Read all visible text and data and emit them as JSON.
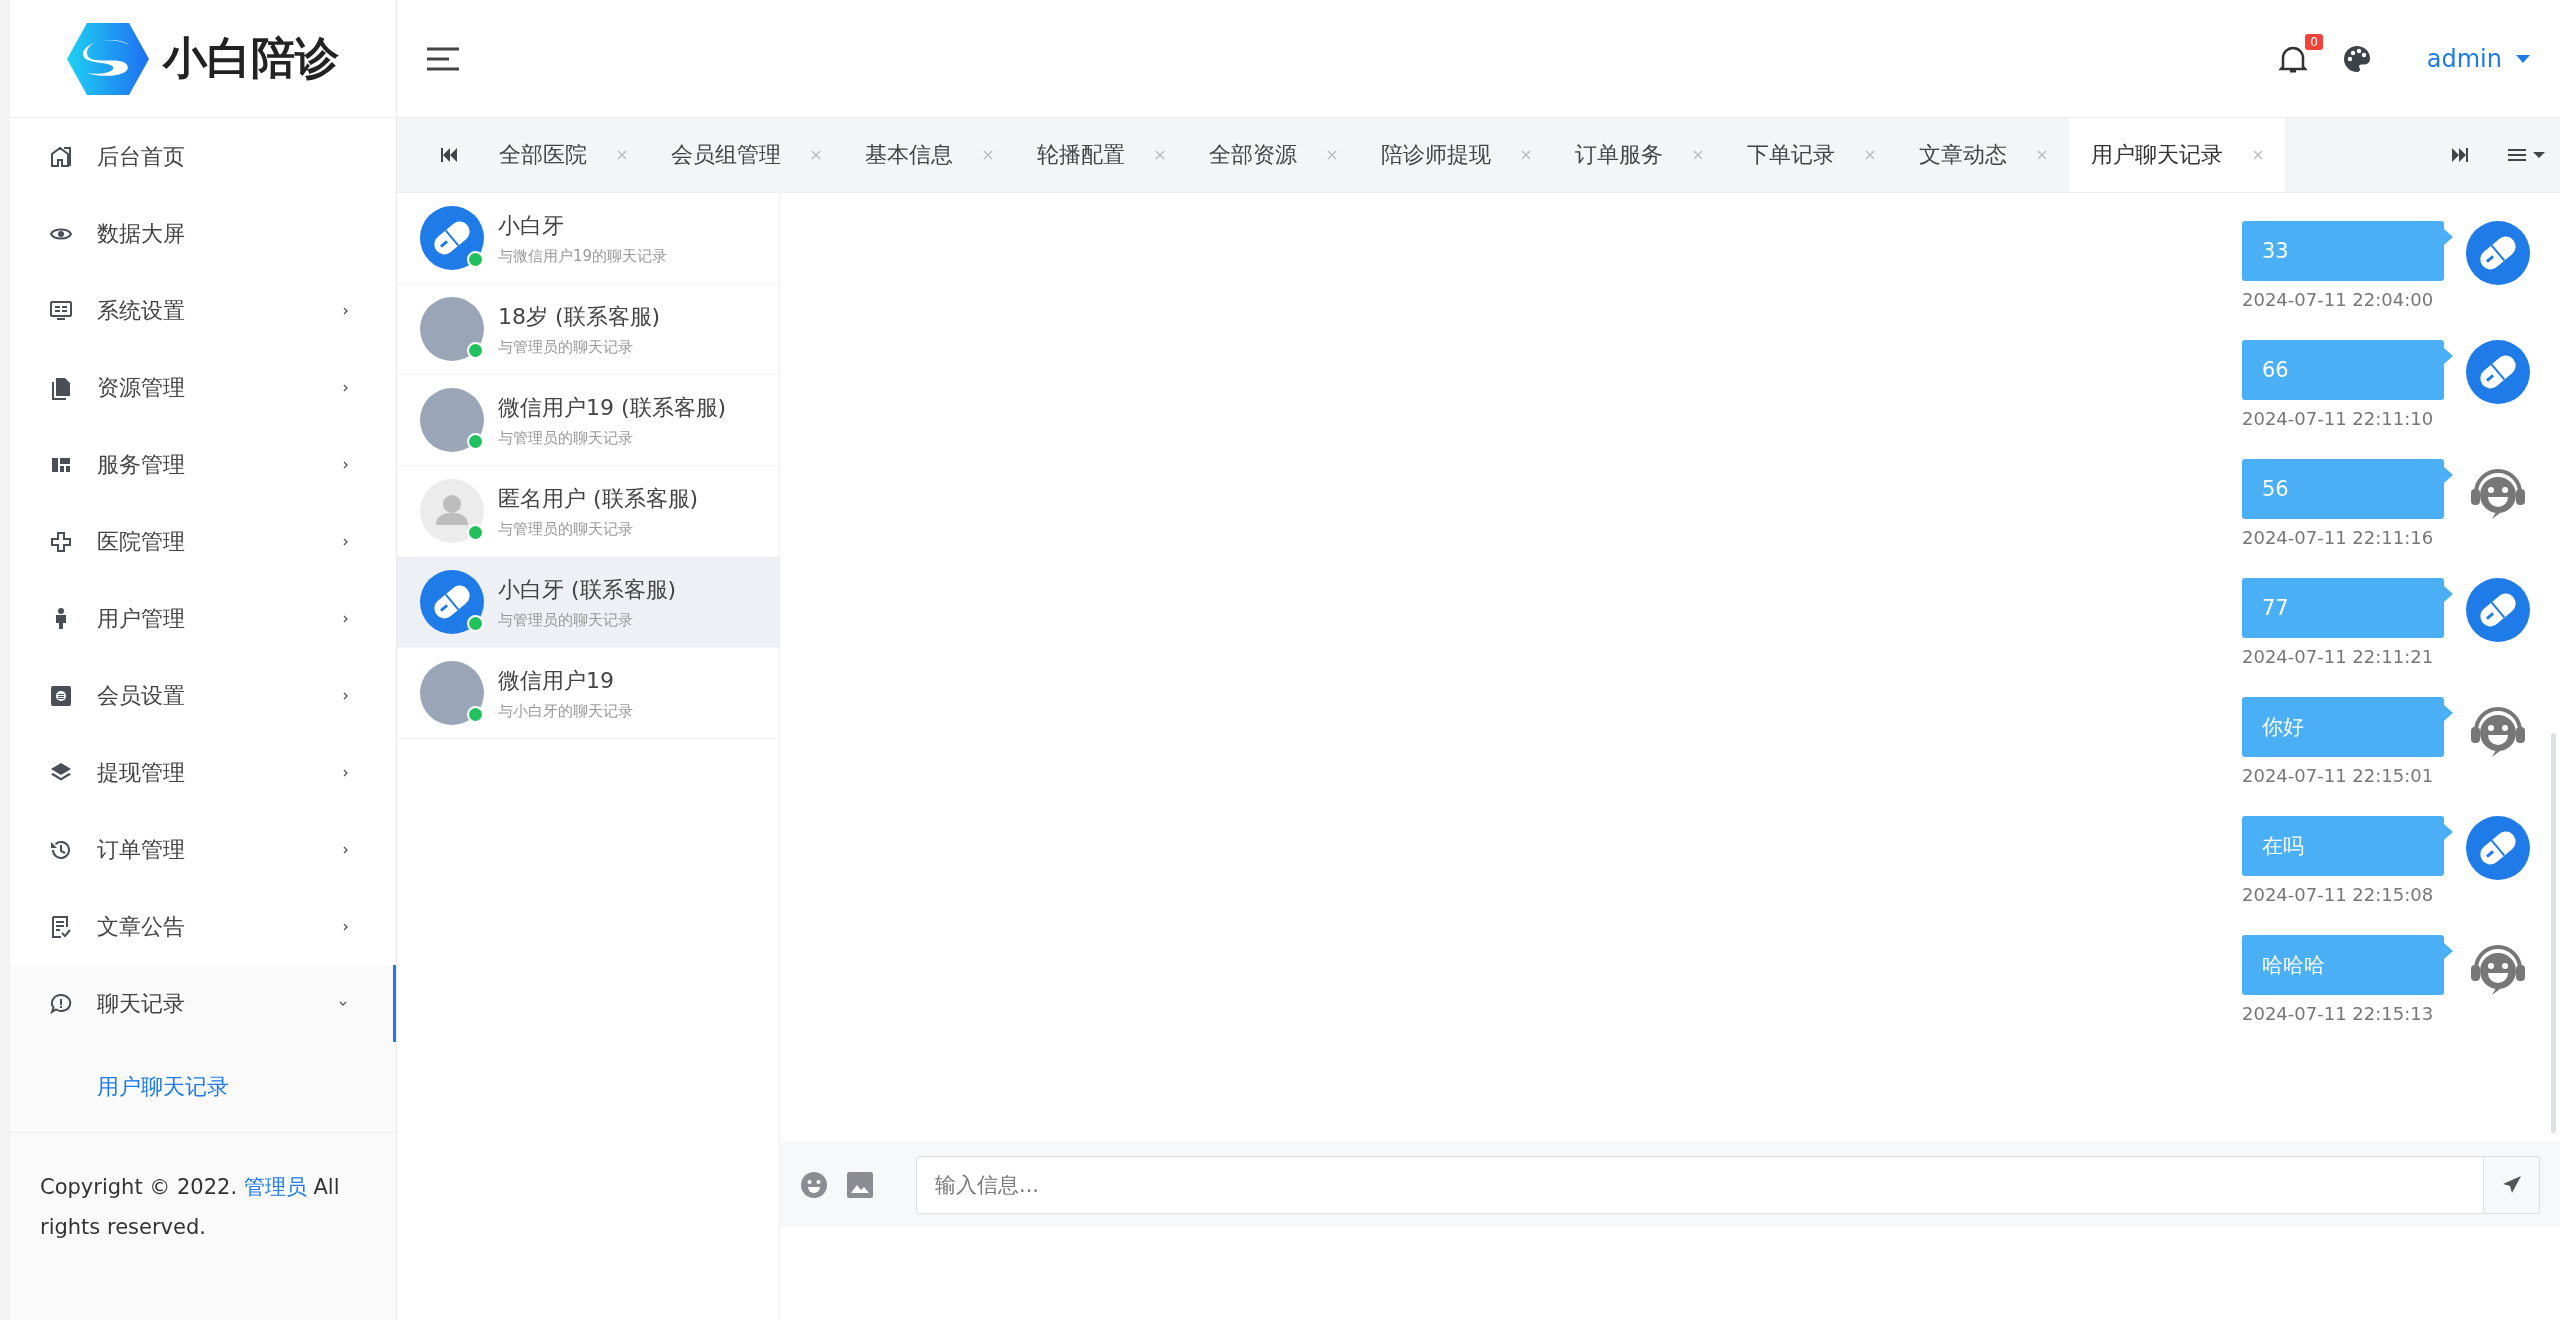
{
  "brand": {
    "name": "小白陪诊"
  },
  "sidebar": {
    "items": [
      {
        "label": "后台首页",
        "has_children": false,
        "selected": false
      },
      {
        "label": "数据大屏",
        "has_children": false,
        "selected": false
      },
      {
        "label": "系统设置",
        "has_children": true,
        "expanded": false,
        "selected": false
      },
      {
        "label": "资源管理",
        "has_children": true,
        "expanded": false,
        "selected": false
      },
      {
        "label": "服务管理",
        "has_children": true,
        "expanded": false,
        "selected": false
      },
      {
        "label": "医院管理",
        "has_children": true,
        "expanded": false,
        "selected": false
      },
      {
        "label": "用户管理",
        "has_children": true,
        "expanded": false,
        "selected": false
      },
      {
        "label": "会员设置",
        "has_children": true,
        "expanded": false,
        "selected": false
      },
      {
        "label": "提现管理",
        "has_children": true,
        "expanded": false,
        "selected": false
      },
      {
        "label": "订单管理",
        "has_children": true,
        "expanded": false,
        "selected": false
      },
      {
        "label": "文章公告",
        "has_children": true,
        "expanded": false,
        "selected": false
      },
      {
        "label": "聊天记录",
        "has_children": true,
        "expanded": true,
        "selected": true,
        "children": [
          {
            "label": "用户聊天记录",
            "selected": true
          }
        ]
      }
    ],
    "footer": {
      "before": "Copyright © 2022. ",
      "link": "管理员",
      "after": " All rights reserved."
    }
  },
  "topbar": {
    "notification_count": "0",
    "user": "admin"
  },
  "tabs": [
    {
      "label": "全部医院",
      "selected": false
    },
    {
      "label": "会员组管理",
      "selected": false
    },
    {
      "label": "基本信息",
      "selected": false
    },
    {
      "label": "轮播配置",
      "selected": false
    },
    {
      "label": "全部资源",
      "selected": false
    },
    {
      "label": "陪诊师提现",
      "selected": false
    },
    {
      "label": "订单服务",
      "selected": false
    },
    {
      "label": "下单记录",
      "selected": false
    },
    {
      "label": "文章动态",
      "selected": false
    },
    {
      "label": "用户聊天记录",
      "selected": true
    }
  ],
  "conversations": [
    {
      "name": "小白牙",
      "subtitle": "与微信用户19的聊天记录",
      "kind": "pill",
      "online": true,
      "selected": false
    },
    {
      "name": "18岁 (联系客服)",
      "subtitle": "与管理员的聊天记录",
      "kind": "photo",
      "online": true,
      "selected": false
    },
    {
      "name": "微信用户19 (联系客服)",
      "subtitle": "与管理员的聊天记录",
      "kind": "photo",
      "online": true,
      "selected": false
    },
    {
      "name": "匿名用户 (联系客服)",
      "subtitle": "与管理员的聊天记录",
      "kind": "default",
      "online": true,
      "selected": false
    },
    {
      "name": "小白牙 (联系客服)",
      "subtitle": "与管理员的聊天记录",
      "kind": "pill",
      "online": true,
      "selected": true
    },
    {
      "name": "微信用户19",
      "subtitle": "与小白牙的聊天记录",
      "kind": "photo",
      "online": true,
      "selected": false
    }
  ],
  "messages": [
    {
      "text": "33",
      "time": "2024-07-11 22:04:00",
      "kind": "pill"
    },
    {
      "text": "66",
      "time": "2024-07-11 22:11:10",
      "kind": "pill"
    },
    {
      "text": "56",
      "time": "2024-07-11 22:11:16",
      "kind": "agent"
    },
    {
      "text": "77",
      "time": "2024-07-11 22:11:21",
      "kind": "pill"
    },
    {
      "text": "你好",
      "time": "2024-07-11 22:15:01",
      "kind": "agent"
    },
    {
      "text": "在吗",
      "time": "2024-07-11 22:15:08",
      "kind": "pill"
    },
    {
      "text": "哈哈哈",
      "time": "2024-07-11 22:15:13",
      "kind": "agent"
    }
  ],
  "composer": {
    "placeholder": "输入信息..."
  }
}
